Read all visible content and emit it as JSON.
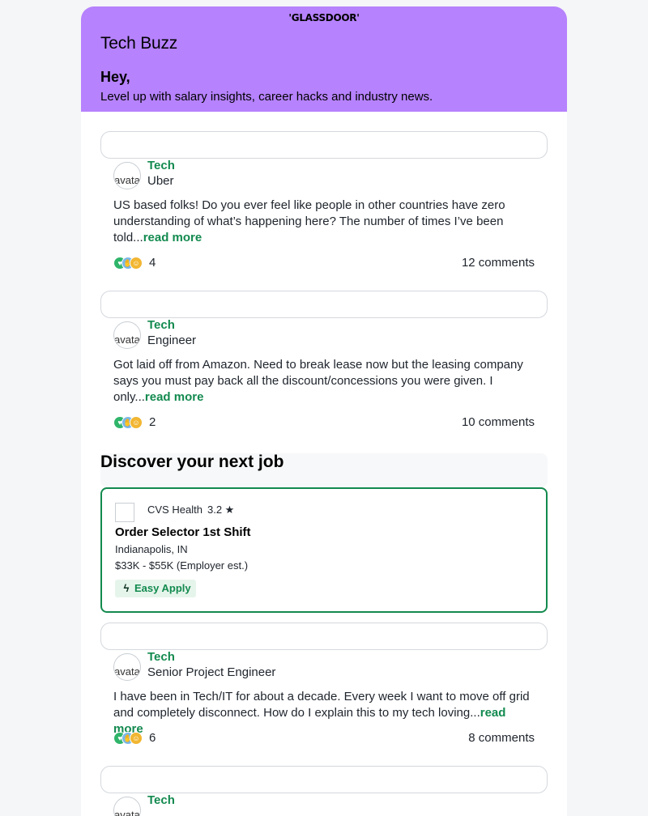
{
  "header": {
    "logo": "'GLASSDOOR'",
    "title": "Tech Buzz",
    "greeting": "Hey,",
    "subtitle": "Level up with salary insights, career hacks and industry news."
  },
  "posts": [
    {
      "category": "Tech",
      "role": "Uber",
      "avatar_alt": "avatar",
      "body": "US based folks! Do you ever feel like people in other countries have zero understanding of what’s happening here? The number of times I’ve been told...",
      "read_more": "read more",
      "reaction_count": "4",
      "comments": "12 comments"
    },
    {
      "category": "Tech",
      "role": "Engineer",
      "avatar_alt": "avatar",
      "body": "Got laid off from Amazon. Need to break lease now but the leasing company says you must pay back all the discount/concessions you were given. I only...",
      "read_more": "read more",
      "reaction_count": "2",
      "comments": "10 comments"
    },
    {
      "category": "Tech",
      "role": "Senior Project Engineer",
      "avatar_alt": "avatar",
      "body": "I have been in Tech/IT for about a decade. Every week I want to move off grid and completely disconnect. How do I explain this to my tech loving...",
      "read_more": "read more",
      "reaction_count": "6",
      "comments": "8 comments"
    },
    {
      "category": "Tech",
      "avatar_alt": "avatar"
    }
  ],
  "jobs": {
    "section_title": "Discover your next job",
    "card": {
      "company": "CVS Health",
      "rating": "3.2 ★",
      "title": "Order Selector 1st Shift",
      "location": "Indianapolis, IN",
      "salary": "$33K - $55K (Employer est.)",
      "apply_label": "Easy Apply"
    }
  },
  "icons": {
    "reactions": [
      "heart-icon",
      "hands-icon",
      "laugh-icon"
    ],
    "easy_apply": "lightning-bolt-icon"
  },
  "colors": {
    "hero_bg": "#b682fd",
    "brand_green": "#138a4f",
    "easy_apply_bg": "#e6f5ec"
  }
}
